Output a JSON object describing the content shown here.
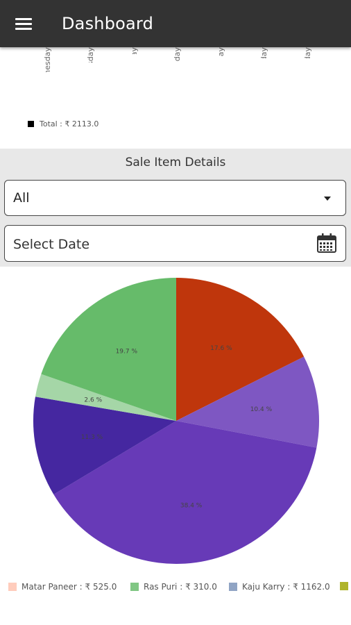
{
  "app_bar": {
    "title": "Dashboard",
    "menu_icon": "hamburger-menu-icon"
  },
  "sales_chart": {
    "days": [
      "Wednesday",
      "Thursday",
      "Friday",
      "Saturday",
      "Sunday",
      "Monday",
      "Tuesday"
    ],
    "legend_total": "Total : ₹ 2113.0"
  },
  "sale_item_details": {
    "title": "Sale Item Details",
    "filter": {
      "selected": "All"
    },
    "date": {
      "placeholder": "Select Date",
      "icon": "calendar-icon"
    }
  },
  "chart_data": {
    "type": "pie",
    "slices": [
      {
        "label": "",
        "percent": 17.6,
        "color": "#bf360c",
        "display": "17.6 %"
      },
      {
        "label": "",
        "percent": 10.4,
        "color": "#7e57c2",
        "display": "10.4 %"
      },
      {
        "label": "",
        "percent": 38.4,
        "color": "#673ab7",
        "display": "38.4 %"
      },
      {
        "label": "",
        "percent": 11.3,
        "color": "#4527a0",
        "display": "11.3 %"
      },
      {
        "label": "",
        "percent": 2.6,
        "color": "#a5d6a7",
        "display": "2.6 %"
      },
      {
        "label": "",
        "percent": 19.7,
        "color": "#66bb6a",
        "display": "19.7 %"
      }
    ],
    "legend": [
      {
        "label": "Matar Paneer : ₹ 525.0",
        "color": "#ffccbc"
      },
      {
        "label": "Ras Puri : ₹ 310.0",
        "color": "#81c784"
      },
      {
        "label": "Kaju Karry : ₹ 1162.0",
        "color": "#90a4c4"
      },
      {
        "label": "",
        "color": "#afb42b"
      }
    ]
  }
}
